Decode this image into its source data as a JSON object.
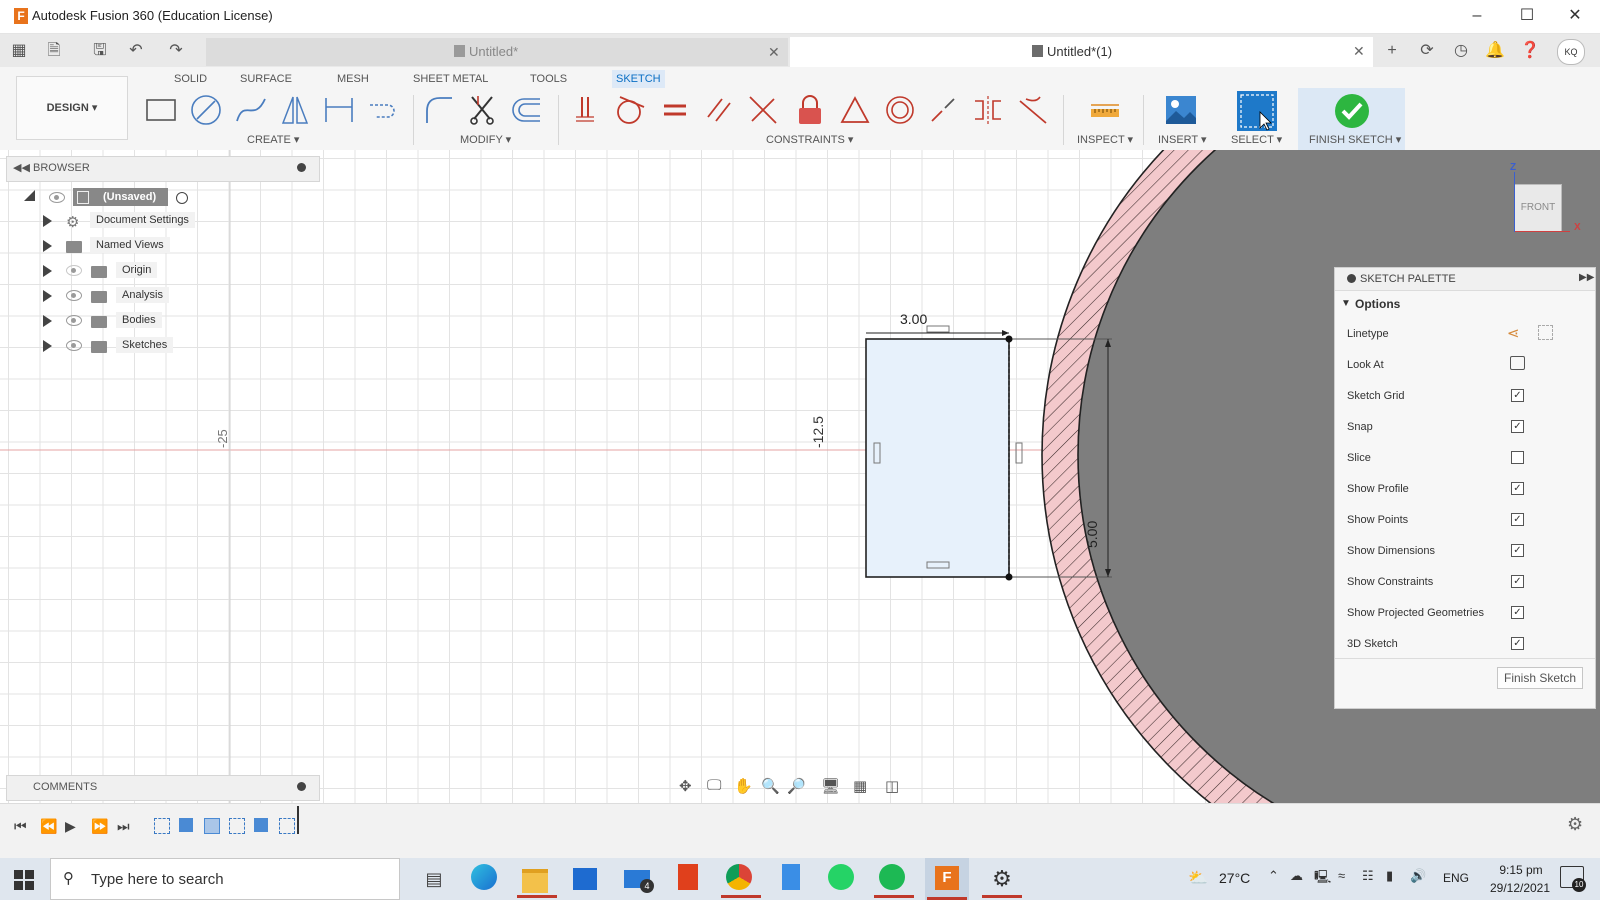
{
  "window": {
    "title": "Autodesk Fusion 360 (Education License)",
    "app_letter": "F"
  },
  "tabs": [
    {
      "label": "Untitled*",
      "active": false
    },
    {
      "label": "Untitled*(1)",
      "active": true
    }
  ],
  "user_initials": "KQ",
  "workspace": {
    "label": "DESIGN ▾"
  },
  "toolbar_tabs": [
    "SOLID",
    "SURFACE",
    "MESH",
    "SHEET METAL",
    "TOOLS",
    "SKETCH"
  ],
  "toolbar_groups": {
    "create": "CREATE ▾",
    "modify": "MODIFY ▾",
    "constraints": "CONSTRAINTS ▾",
    "inspect": "INSPECT ▾",
    "insert": "INSERT ▾",
    "select": "SELECT ▾",
    "finish": "FINISH SKETCH ▾"
  },
  "browser": {
    "title": "BROWSER",
    "root": "(Unsaved)",
    "items": [
      "Document Settings",
      "Named Views",
      "Origin",
      "Analysis",
      "Bodies",
      "Sketches"
    ]
  },
  "comments": {
    "title": "COMMENTS"
  },
  "canvas": {
    "dim_width": "3.00",
    "dim_height": "5.00",
    "dim_offset": "-12.5",
    "axis_label": "-25",
    "viewcube": "FRONT",
    "viewcube_axis_z": "Z",
    "viewcube_axis_x": "X"
  },
  "palette": {
    "title": "SKETCH PALETTE",
    "section": "Options",
    "rows": [
      {
        "label": "Linetype",
        "checked": null
      },
      {
        "label": "Look At",
        "checked": null
      },
      {
        "label": "Sketch Grid",
        "checked": true
      },
      {
        "label": "Snap",
        "checked": true
      },
      {
        "label": "Slice",
        "checked": false
      },
      {
        "label": "Show Profile",
        "checked": true
      },
      {
        "label": "Show Points",
        "checked": true
      },
      {
        "label": "Show Dimensions",
        "checked": true
      },
      {
        "label": "Show Constraints",
        "checked": true
      },
      {
        "label": "Show Projected Geometries",
        "checked": true
      },
      {
        "label": "3D Sketch",
        "checked": true
      }
    ],
    "finish_button": "Finish Sketch"
  },
  "taskbar": {
    "search_placeholder": "Type here to search",
    "mail_badge": "4",
    "weather": "27°C",
    "language": "ENG",
    "time": "9:15 pm",
    "date": "29/12/2021",
    "notif_count": "10"
  },
  "colors": {
    "accent": "#0a6fc4",
    "finish_green": "#2db640",
    "hatch": "#f3c9cc",
    "profile": "#e7f1fb"
  }
}
